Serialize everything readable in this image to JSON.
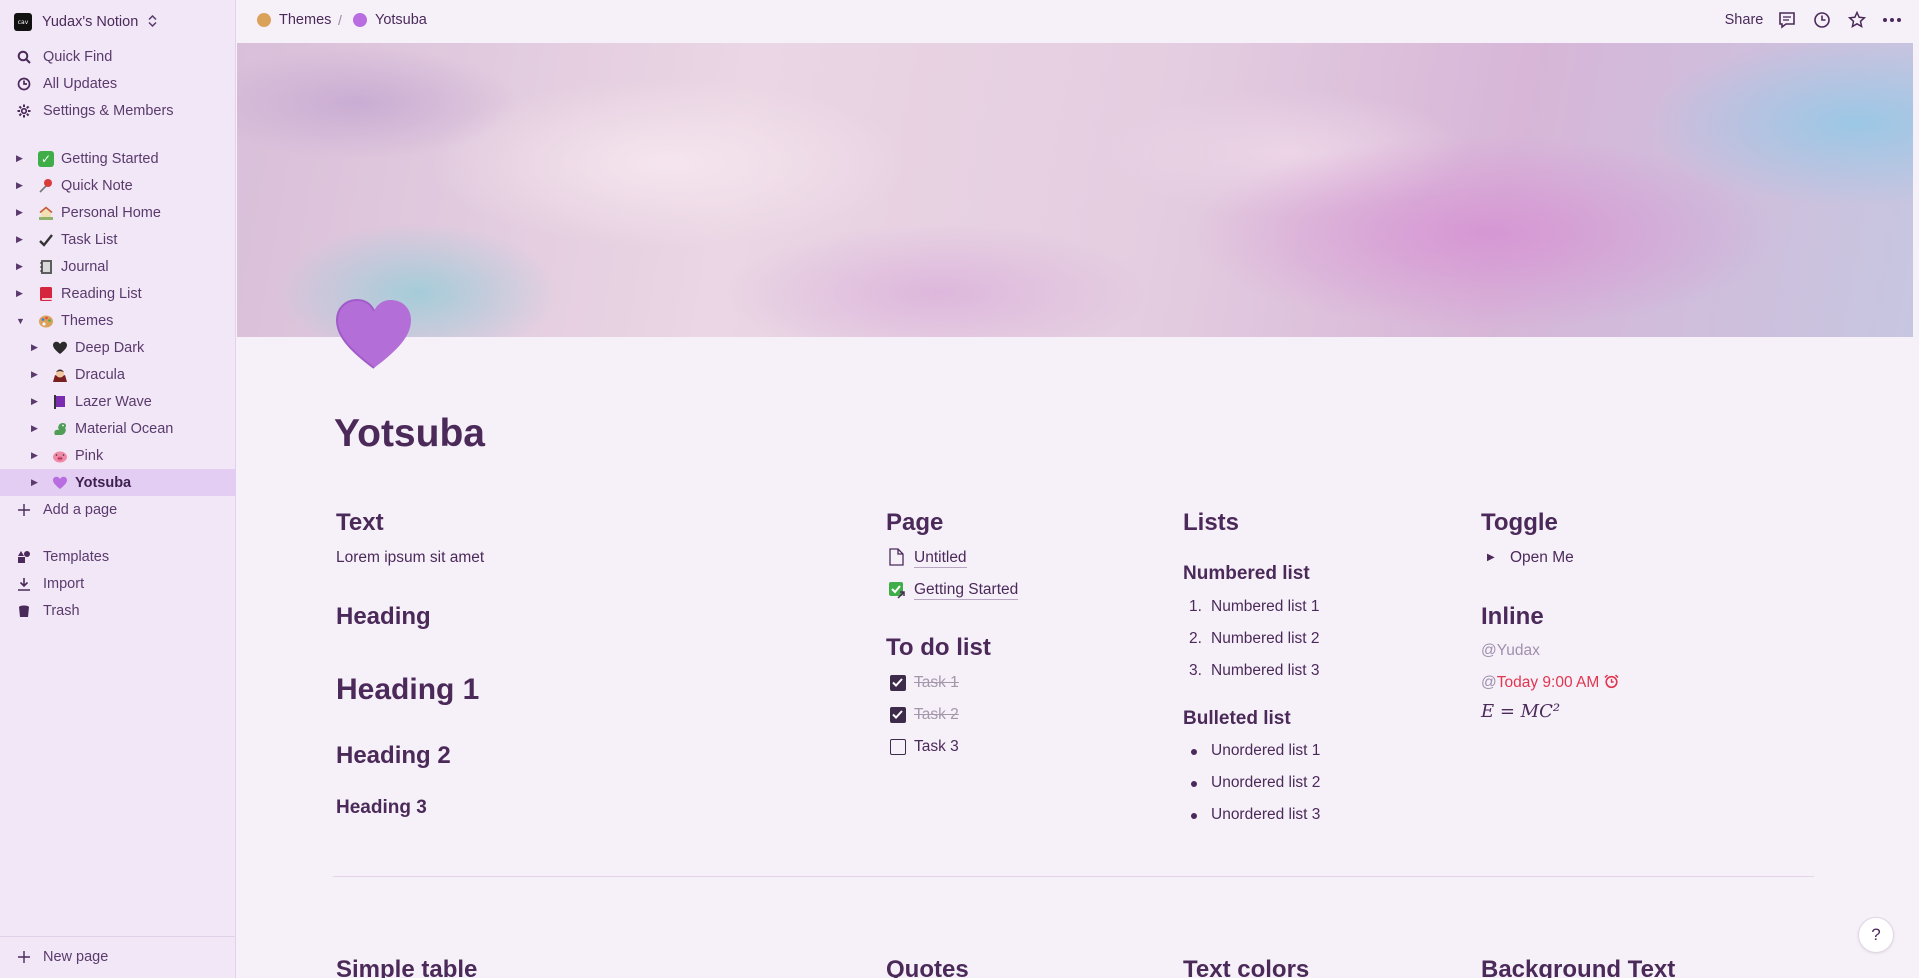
{
  "workspace": {
    "name": "Yudax's Notion",
    "logo_text": "cav"
  },
  "sidebar": {
    "nav": [
      {
        "label": "Quick Find",
        "icon": "search-icon"
      },
      {
        "label": "All Updates",
        "icon": "clock-icon"
      },
      {
        "label": "Settings & Members",
        "icon": "gear-icon"
      }
    ],
    "pages": [
      {
        "label": "Getting Started",
        "icon": "check-box-emoji",
        "color": "#3fae49"
      },
      {
        "label": "Quick Note",
        "icon": "pin-emoji",
        "color": "#d93b3b"
      },
      {
        "label": "Personal Home",
        "icon": "house-emoji",
        "color": "#8fb36a"
      },
      {
        "label": "Task List",
        "icon": "checkmark-emoji",
        "color": "#333333"
      },
      {
        "label": "Journal",
        "icon": "notebook-emoji",
        "color": "#5e5e5e"
      },
      {
        "label": "Reading List",
        "icon": "book-emoji",
        "color": "#d6263d"
      },
      {
        "label": "Themes",
        "icon": "palette-emoji",
        "color": "#d9a15a"
      }
    ],
    "theme_children": [
      {
        "label": "Deep Dark",
        "icon": "black-heart-emoji",
        "color": "#2b2b2b"
      },
      {
        "label": "Dracula",
        "icon": "vampire-emoji",
        "color": "#a3473b"
      },
      {
        "label": "Lazer Wave",
        "icon": "flag-emoji",
        "color": "#7a2bb0"
      },
      {
        "label": "Material Ocean",
        "icon": "dragon-emoji",
        "color": "#4f9d57"
      },
      {
        "label": "Pink",
        "icon": "pig-emoji",
        "color": "#f08aa6"
      },
      {
        "label": "Yotsuba",
        "icon": "purple-heart-emoji",
        "color": "#b86ee0"
      }
    ],
    "add_page": "Add a page",
    "tools": [
      {
        "label": "Templates",
        "icon": "shapes-icon"
      },
      {
        "label": "Import",
        "icon": "download-icon"
      },
      {
        "label": "Trash",
        "icon": "trash-icon"
      }
    ],
    "new_page": "New page"
  },
  "topbar": {
    "breadcrumb": [
      {
        "label": "Themes",
        "color": "#d9a15a"
      },
      {
        "label": "Yotsuba",
        "color": "#b86ee0"
      }
    ],
    "separator": "/",
    "share": "Share"
  },
  "page": {
    "title": "Yotsuba",
    "accent": "#b86ee0",
    "text_col": {
      "heading": "Text",
      "body": "Lorem ipsum sit amet",
      "heading_label": "Heading",
      "h1": "Heading 1",
      "h2": "Heading 2",
      "h3": "Heading 3"
    },
    "page_col": {
      "heading": "Page",
      "links": [
        "Untitled",
        "Getting Started"
      ],
      "todo_heading": "To do list",
      "todos": [
        {
          "label": "Task 1",
          "done": true
        },
        {
          "label": "Task 2",
          "done": true
        },
        {
          "label": "Task 3",
          "done": false
        }
      ]
    },
    "lists_col": {
      "heading": "Lists",
      "numbered_heading": "Numbered list",
      "numbered": [
        "Numbered list 1",
        "Numbered list 2",
        "Numbered list 3"
      ],
      "numbers": [
        "1.",
        "2.",
        "3."
      ],
      "bulleted_heading": "Bulleted list",
      "bulleted": [
        "Unordered list 1",
        "Unordered list 2",
        "Unordered list 3"
      ]
    },
    "toggle_col": {
      "heading": "Toggle",
      "toggle_label": "Open Me",
      "inline_heading": "Inline",
      "mention_user": "@Yudax",
      "mention_date_at": "@",
      "mention_date": "Today 9:00 AM",
      "equation": "E = MC²"
    },
    "lower_headings": [
      "Simple table",
      "Quotes",
      "Text colors",
      "Background Text"
    ]
  },
  "help": "?"
}
